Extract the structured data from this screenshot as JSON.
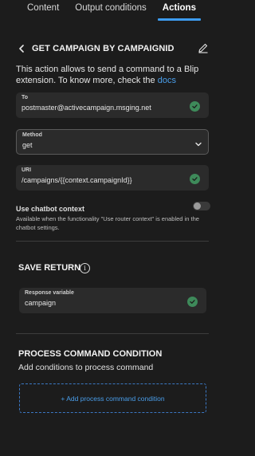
{
  "tabs": [
    {
      "label": "Content"
    },
    {
      "label": "Output conditions"
    },
    {
      "label": "Actions"
    }
  ],
  "header": {
    "title": "GET CAMPAIGN BY CAMPAIGNID"
  },
  "description": {
    "text": "This action allows to send a command to a Blip extension. To know more, check the ",
    "link": "docs"
  },
  "fields": {
    "to": {
      "label": "To",
      "value": "postmaster@activecampaign.msging.net"
    },
    "method": {
      "label": "Method",
      "value": "get"
    },
    "uri": {
      "label": "URI",
      "value": "/campaigns/{{context.campaignId}}"
    }
  },
  "chatbot_context": {
    "label": "Use chatbot context",
    "helper": "Available when the functionality \"Use router context\" is enabled in the chatbot settings.",
    "enabled": false
  },
  "save_return": {
    "title": "SAVE RETURN",
    "response_label": "Response variable",
    "response_value": "campaign"
  },
  "process_condition": {
    "title": "PROCESS COMMAND CONDITION",
    "subtitle": "Add conditions to process command",
    "add_label": "+ Add process command condition"
  },
  "icons": {
    "back": "chevron-left-icon",
    "edit": "pencil-icon",
    "check": "check-circle-icon",
    "dropdown": "chevron-down-icon",
    "info": "info-icon"
  },
  "colors": {
    "accent": "#3d9cf0",
    "success": "#3e8a5a",
    "background": "#1c1c1c"
  }
}
